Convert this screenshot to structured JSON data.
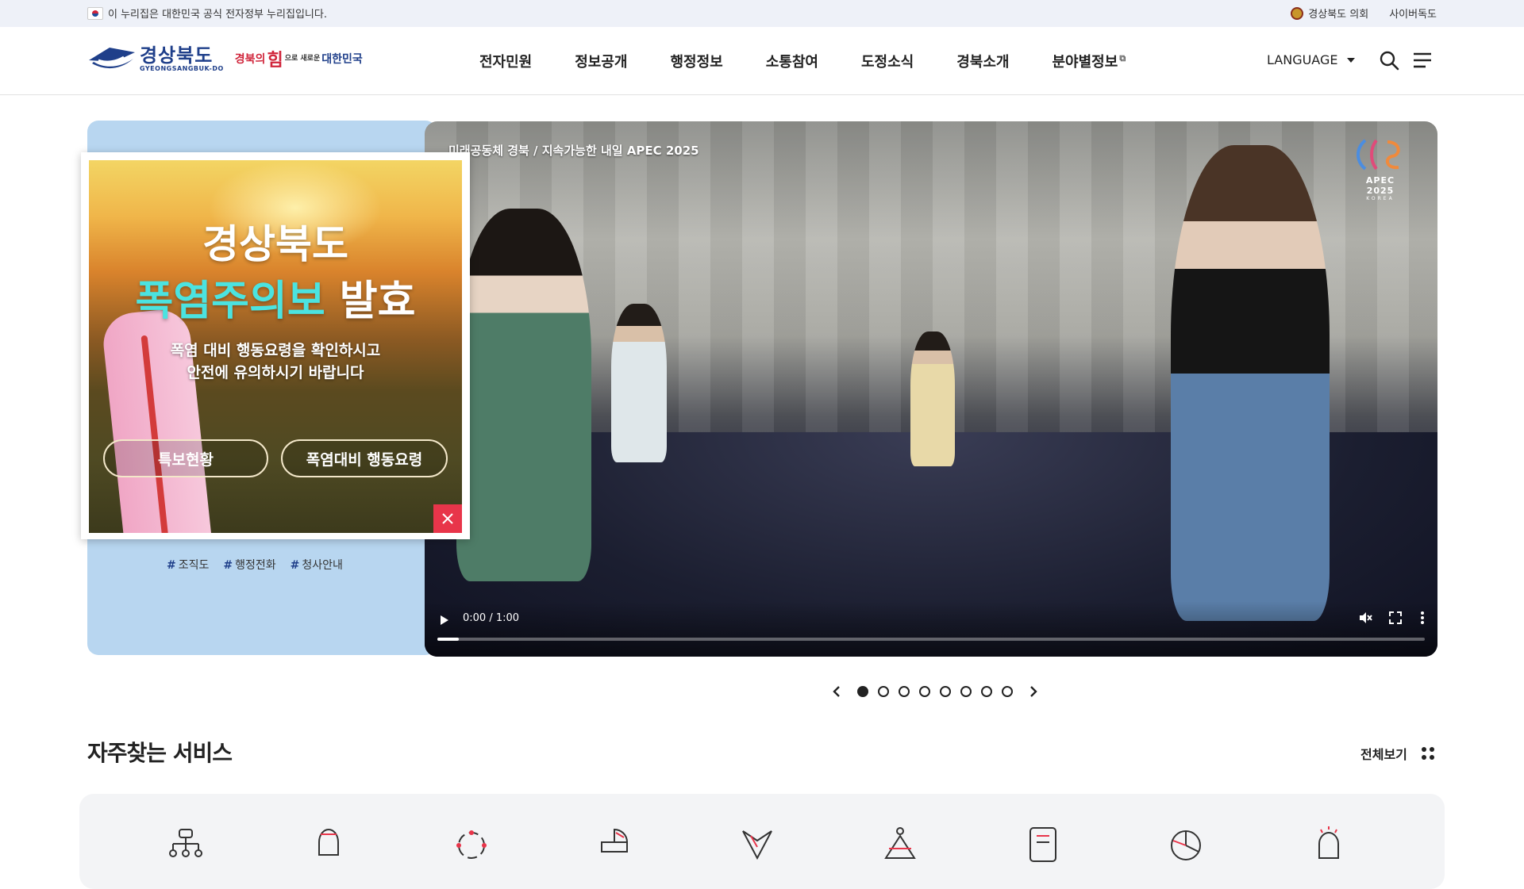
{
  "govbar": {
    "notice": "이 누리집은 대한민국 공식 전자정부 누리집입니다.",
    "links": [
      "경상북도 의회",
      "사이버독도"
    ]
  },
  "header": {
    "logo_ko": "경상북도",
    "logo_en": "GYEONGSANGBUK-DO",
    "slogan_main": "경북의",
    "slogan_red": "힘",
    "slogan_small": "으로 새로운",
    "slogan_end": "대한민국",
    "nav": [
      "전자민원",
      "정보공개",
      "행정정보",
      "소통참여",
      "도정소식",
      "경북소개",
      "분야별정보"
    ],
    "language": "LANGUAGE",
    "icons": [
      "search-icon",
      "menu-icon"
    ]
  },
  "popup": {
    "title_line1": "경상북도",
    "title_highlight": "폭염주의보",
    "title_rest": " 발효",
    "desc_line1": "폭염 대비 행동요령을 확인하시고",
    "desc_line2": "안전에 유의하시기 바랍니다",
    "button1": "특보현황",
    "button2": "폭염대비 행동요령",
    "highlight_color": "#4be3e0"
  },
  "left_panel": {
    "tags": [
      {
        "hash": "#",
        "label": "조직도"
      },
      {
        "hash": "#",
        "label": "행정전화"
      },
      {
        "hash": "#",
        "label": "청사안내"
      }
    ]
  },
  "video": {
    "title": "미래공동체 경북 / 지속가능한 내일 APEC 2025",
    "apec_label": "APEC 2025",
    "apec_sub": "KOREA",
    "time": "0:00 / 1:00",
    "progress": 0.022
  },
  "slider": {
    "count": 8,
    "active_index": 0
  },
  "services": {
    "title": "자주찾는 서비스",
    "view_all": "전체보기",
    "icons": [
      "organization-icon",
      "bell-icon",
      "circle-nodes-icon",
      "stroller-icon",
      "vote-icon",
      "person-location-icon",
      "document-icon",
      "pie-chart-icon",
      "alarm-icon"
    ]
  },
  "colors": {
    "brand_blue": "#1f3f8a",
    "accent_red": "#e8354a",
    "panel_blue": "#b8d6f0"
  }
}
